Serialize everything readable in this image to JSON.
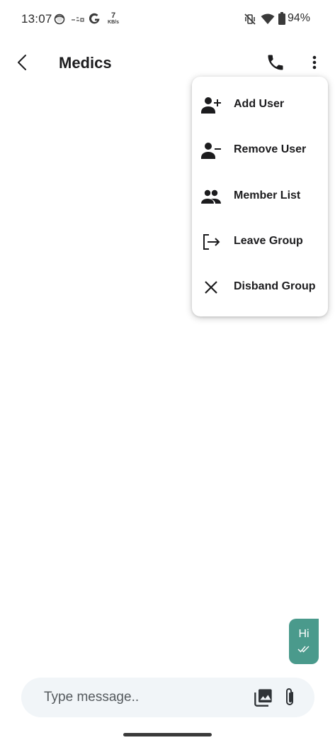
{
  "status_bar": {
    "time": "13:07",
    "net_speed_value": "7",
    "net_speed_unit": "KB/s",
    "battery": "94%",
    "icons": [
      "face-icon",
      "signal-text-icon",
      "google-icon",
      "vibrate-off-icon",
      "wifi-icon",
      "battery-icon"
    ]
  },
  "app_bar": {
    "title": "Medics",
    "icons": [
      "back-arrow-icon",
      "phone-icon",
      "more-vertical-icon"
    ]
  },
  "menu": {
    "items": [
      {
        "label": "Add User",
        "icon": "add-user-icon"
      },
      {
        "label": "Remove User",
        "icon": "remove-user-icon"
      },
      {
        "label": "Member List",
        "icon": "group-icon"
      },
      {
        "label": "Leave Group",
        "icon": "logout-icon"
      },
      {
        "label": "Disband Group",
        "icon": "close-icon"
      }
    ]
  },
  "messages": [
    {
      "text": "Hi",
      "status": "read-double-check"
    }
  ],
  "input": {
    "placeholder": "Type message..",
    "value": ""
  },
  "colors": {
    "bubble": "#4a9a8c",
    "input_background": "#f1f5f8",
    "text": "#1c1c1e"
  }
}
